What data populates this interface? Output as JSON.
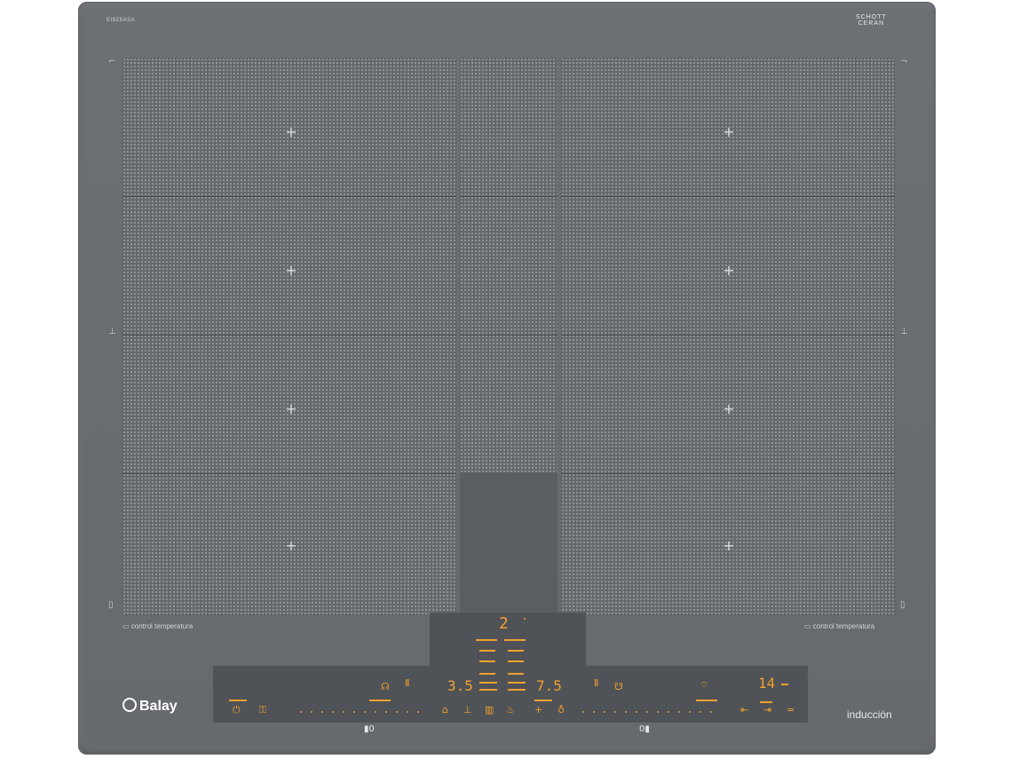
{
  "product": {
    "model_code": "EI9Z5ASA",
    "glass_brand_line1": "SCHOTT",
    "glass_brand_line2": "CERAN",
    "brand": "Balay",
    "tech_label": "inducción"
  },
  "labels": {
    "left_temp": "control temperatura",
    "right_temp": "control temperatura"
  },
  "controls": {
    "top_number": "2",
    "left_value": "3.5",
    "center_right_value": "7.5",
    "timer_value": "14",
    "left_marker": "▮0",
    "right_marker": "0▮"
  },
  "icons": {
    "power": "power-icon",
    "child_lock": "child-lock-icon",
    "wifi": "wifi-icon"
  },
  "colors": {
    "glass": "#6e7276",
    "panel": "#4f5256",
    "accent": "#f0a030"
  }
}
